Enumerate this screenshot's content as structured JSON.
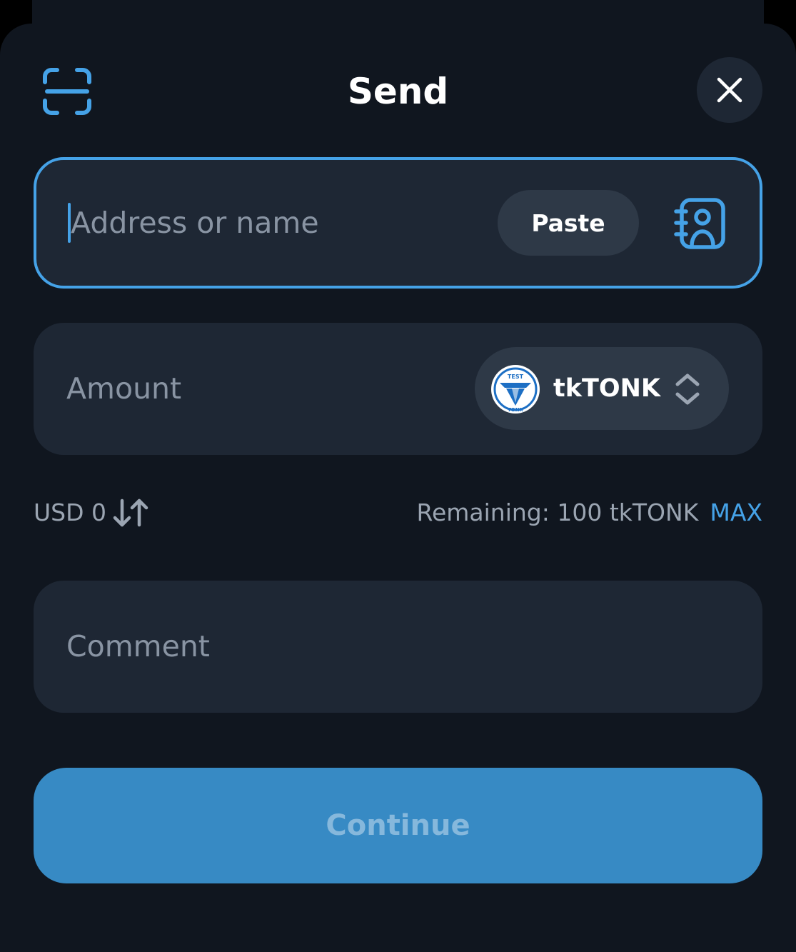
{
  "header": {
    "title": "Send",
    "scan_icon": "qr-scan-icon",
    "close_icon": "close-icon"
  },
  "address": {
    "placeholder": "Address or name",
    "value": "",
    "paste_label": "Paste",
    "contacts_icon": "address-book-icon"
  },
  "amount": {
    "placeholder": "Amount",
    "value": "",
    "token": {
      "symbol": "tkTONK",
      "logo_text_top": "TEST",
      "logo_text_bottom": "TONK",
      "logo_icon": "tktonk-token-logo",
      "chevron_icon": "chevron-up-down-icon"
    }
  },
  "fiat": {
    "label": "USD 0",
    "swap_icon": "swap-arrows-icon"
  },
  "balance": {
    "remaining_label": "Remaining: 100 tkTONK",
    "max_label": "MAX"
  },
  "comment": {
    "placeholder": "Comment",
    "value": ""
  },
  "continue": {
    "label": "Continue",
    "disabled": true
  },
  "colors": {
    "background": "#10161f",
    "surface": "#1e2734",
    "chip": "#2e3947",
    "accent": "#45a2e7",
    "primary_button": "#378ac4",
    "primary_button_text_disabled": "#86b8dc",
    "secondary_text": "#9ba5b2",
    "placeholder_text": "#8994a3"
  }
}
